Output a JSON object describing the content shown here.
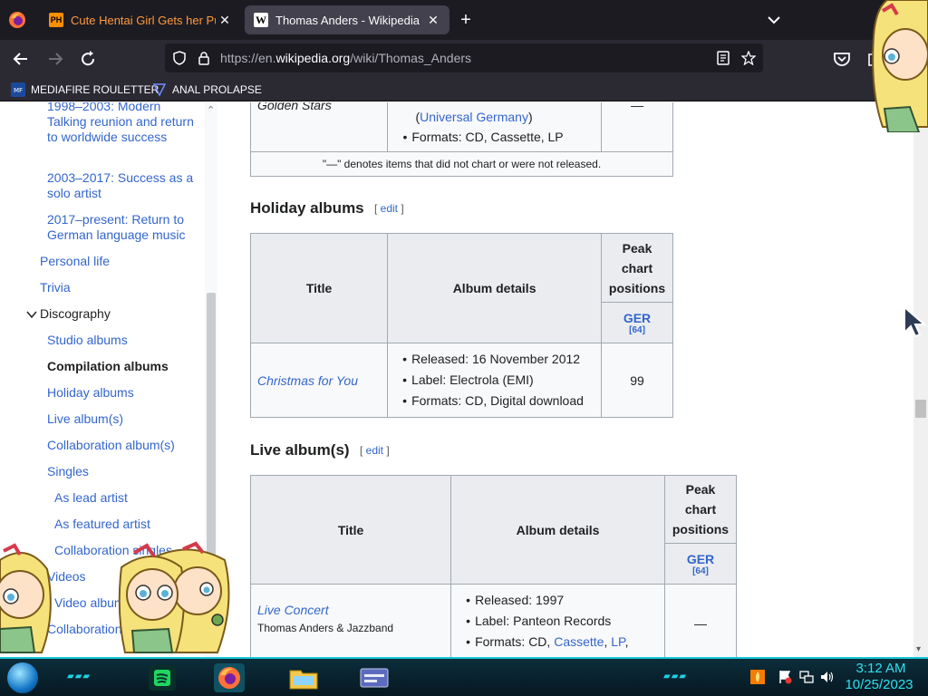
{
  "browser": {
    "tabs": [
      {
        "title": "Cute Hentai Girl Gets her Pussy",
        "favicon": "PH",
        "active": false
      },
      {
        "title": "Thomas Anders - Wikipedia",
        "favicon": "W",
        "active": true
      }
    ],
    "url": {
      "prefix": "https://en.",
      "domain": "wikipedia.org",
      "path": "/wiki/Thomas_Anders"
    },
    "bookmarks": [
      "MEDIAFIRE ROULETTER",
      "ANAL PROLAPSE"
    ]
  },
  "toc": {
    "items": [
      {
        "label": "1998–2003: Modern Talking reunion and return to worldwide success",
        "state": "link"
      },
      {
        "label": "2003–2017: Success as a solo artist",
        "state": "link"
      },
      {
        "label": "2017–present: Return to German language music",
        "state": "link"
      },
      {
        "label": "Personal life",
        "state": "link"
      },
      {
        "label": "Trivia",
        "state": "link"
      },
      {
        "label": "Discography",
        "state": "plain"
      },
      {
        "label": "Studio albums",
        "state": "link"
      },
      {
        "label": "Compilation albums",
        "state": "current"
      },
      {
        "label": "Holiday albums",
        "state": "link"
      },
      {
        "label": "Live album(s)",
        "state": "link"
      },
      {
        "label": "Collaboration album(s)",
        "state": "link"
      },
      {
        "label": "Singles",
        "state": "link"
      },
      {
        "label": "As lead artist",
        "state": "link"
      },
      {
        "label": "As featured artist",
        "state": "link"
      },
      {
        "label": "Collaboration singles",
        "state": "link"
      },
      {
        "label": "Videos",
        "state": "link"
      },
      {
        "label": "Video albums",
        "state": "link"
      },
      {
        "label": "Collaboration",
        "state": "link"
      }
    ]
  },
  "compilation_tail": {
    "title": "Golden Stars",
    "label_link": "Universal Germany",
    "formats": "Formats: CD, Cassette, LP",
    "peak": "—",
    "note": "\"—\" denotes items that did not chart or were not released."
  },
  "holiday": {
    "heading": "Holiday albums",
    "edit": "edit",
    "headers": {
      "title": "Title",
      "details": "Album details",
      "peak": "Peak chart positions",
      "chart": "GER",
      "ref": "[64]"
    },
    "rows": [
      {
        "title": "Christmas for You",
        "released": "Released: 16 November 2012",
        "label": "Label: Electrola (EMI)",
        "formats": "Formats: CD, Digital download",
        "peak": "99"
      }
    ]
  },
  "live": {
    "heading": "Live album(s)",
    "edit": "edit",
    "headers": {
      "title": "Title",
      "details": "Album details",
      "peak": "Peak chart positions",
      "chart": "GER",
      "ref": "[64]"
    },
    "rows": [
      {
        "title": "Live Concert",
        "subtitle": "Thomas Anders & Jazzband",
        "released": "Released: 1997",
        "label": "Label: Panteon Records",
        "formats_prefix": "Formats: CD, ",
        "formats_link1": "Cassette",
        "formats_link2": "LP",
        "peak": "—"
      }
    ]
  },
  "taskbar": {
    "time": "3:12 AM",
    "date": "10/25/2023"
  }
}
